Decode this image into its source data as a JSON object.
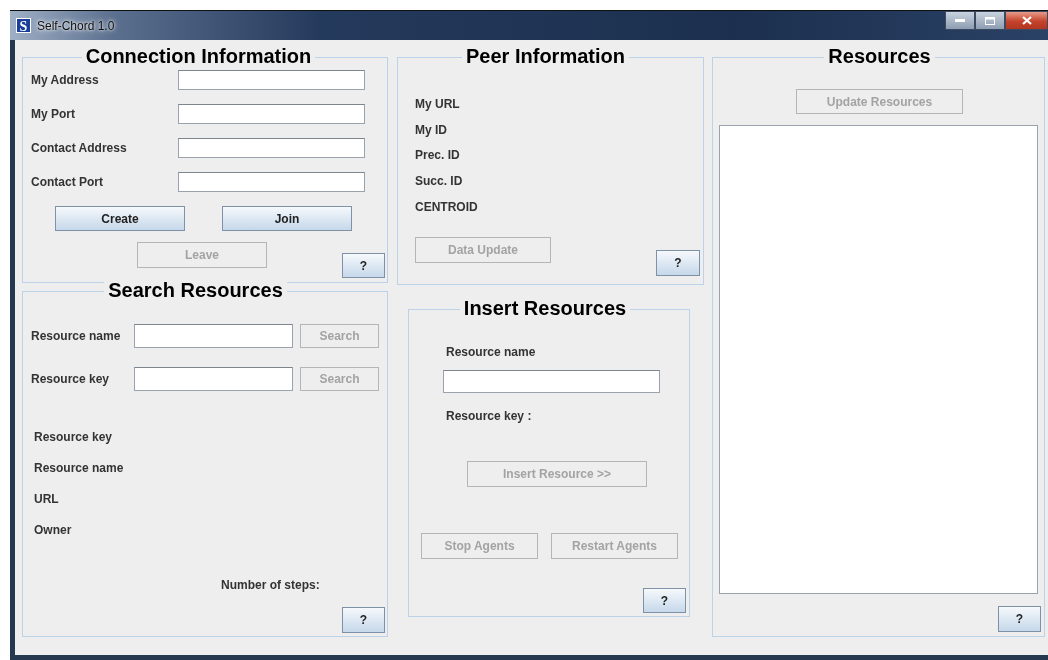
{
  "window": {
    "title": "Self-Chord 1.0",
    "icon_letter": "S"
  },
  "connection_information": {
    "title": "Connection Information",
    "fields": [
      {
        "label": "My Address"
      },
      {
        "label": "My Port"
      },
      {
        "label": "Contact Address"
      },
      {
        "label": "Contact Port"
      }
    ],
    "buttons": [
      {
        "label": "Create",
        "disabled": false
      },
      {
        "label": "Join",
        "disabled": false
      },
      {
        "label": "Leave",
        "disabled": true
      }
    ],
    "help_button": {
      "label": "?",
      "disabled": false
    }
  },
  "search_resources": {
    "title": "Search Resources",
    "search_rows": [
      {
        "label": "Resource name",
        "button": {
          "label": "Search",
          "disabled": true
        }
      },
      {
        "label": "Resource key",
        "button": {
          "label": "Search",
          "disabled": true
        }
      }
    ],
    "result_labels": [
      "Resource key",
      "Resource name",
      "URL",
      "Owner"
    ],
    "steps_label": "Number of steps:",
    "help_button": {
      "label": "?",
      "disabled": false
    }
  },
  "peer_information": {
    "title": "Peer Information",
    "labels": [
      "My URL",
      "My ID",
      "Prec. ID",
      "Succ. ID",
      "CENTROID"
    ],
    "data_update_button": {
      "label": "Data Update",
      "disabled": true
    },
    "help_button": {
      "label": "?",
      "disabled": false
    }
  },
  "insert_resources": {
    "title": "Insert Resources",
    "name_label": "Resource name",
    "key_label": "Resource key :",
    "insert_button": {
      "label": "Insert Resource >>",
      "disabled": true
    },
    "agent_buttons": [
      {
        "label": "Stop Agents",
        "disabled": true
      },
      {
        "label": "Restart Agents",
        "disabled": true
      }
    ],
    "help_button": {
      "label": "?",
      "disabled": false
    }
  },
  "resources": {
    "title": "Resources",
    "update_button": {
      "label": "Update Resources",
      "disabled": true
    },
    "help_button": {
      "label": "?",
      "disabled": false
    }
  }
}
